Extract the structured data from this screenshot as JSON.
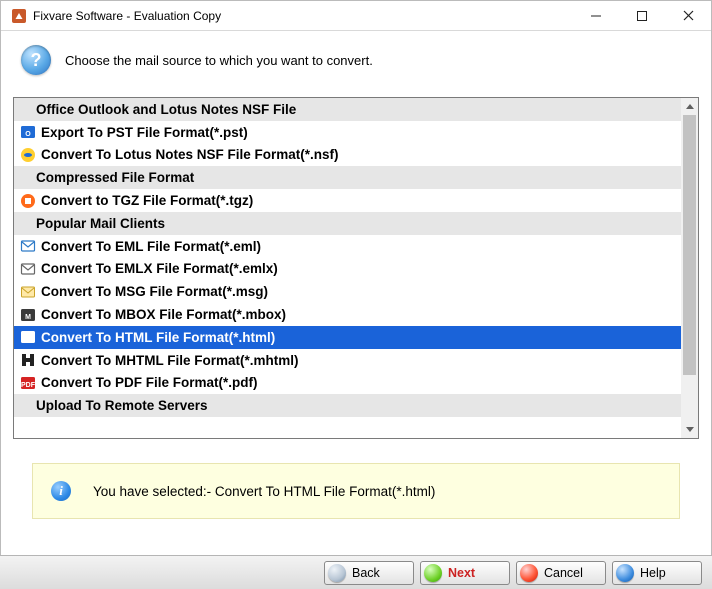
{
  "title": "Fixvare Software - Evaluation Copy",
  "prompt": "Choose the mail source to which you want to convert.",
  "rows": [
    {
      "type": "cat",
      "label": "Office Outlook and Lotus Notes NSF File"
    },
    {
      "type": "item",
      "label": "Export To PST File Format(*.pst)",
      "icon": "outlook"
    },
    {
      "type": "item",
      "label": "Convert To Lotus Notes NSF File Format(*.nsf)",
      "icon": "nsf"
    },
    {
      "type": "cat",
      "label": "Compressed File Format"
    },
    {
      "type": "item",
      "label": "Convert to TGZ File Format(*.tgz)",
      "icon": "tgz"
    },
    {
      "type": "cat",
      "label": "Popular Mail Clients"
    },
    {
      "type": "item",
      "label": "Convert To EML File Format(*.eml)",
      "icon": "eml"
    },
    {
      "type": "item",
      "label": "Convert To EMLX File Format(*.emlx)",
      "icon": "emlx"
    },
    {
      "type": "item",
      "label": "Convert To MSG File Format(*.msg)",
      "icon": "msg"
    },
    {
      "type": "item",
      "label": "Convert To MBOX File Format(*.mbox)",
      "icon": "mbox"
    },
    {
      "type": "item",
      "label": "Convert To HTML File Format(*.html)",
      "icon": "html",
      "selected": true
    },
    {
      "type": "item",
      "label": "Convert To MHTML File Format(*.mhtml)",
      "icon": "mhtml"
    },
    {
      "type": "item",
      "label": "Convert To PDF File Format(*.pdf)",
      "icon": "pdf"
    },
    {
      "type": "cat",
      "label": "Upload To Remote Servers"
    }
  ],
  "notice_prefix": "You have selected:- ",
  "notice_selection": "Convert To HTML File Format(*.html)",
  "buttons": {
    "back": "Back",
    "next": "Next",
    "cancel": "Cancel",
    "help": "Help"
  }
}
